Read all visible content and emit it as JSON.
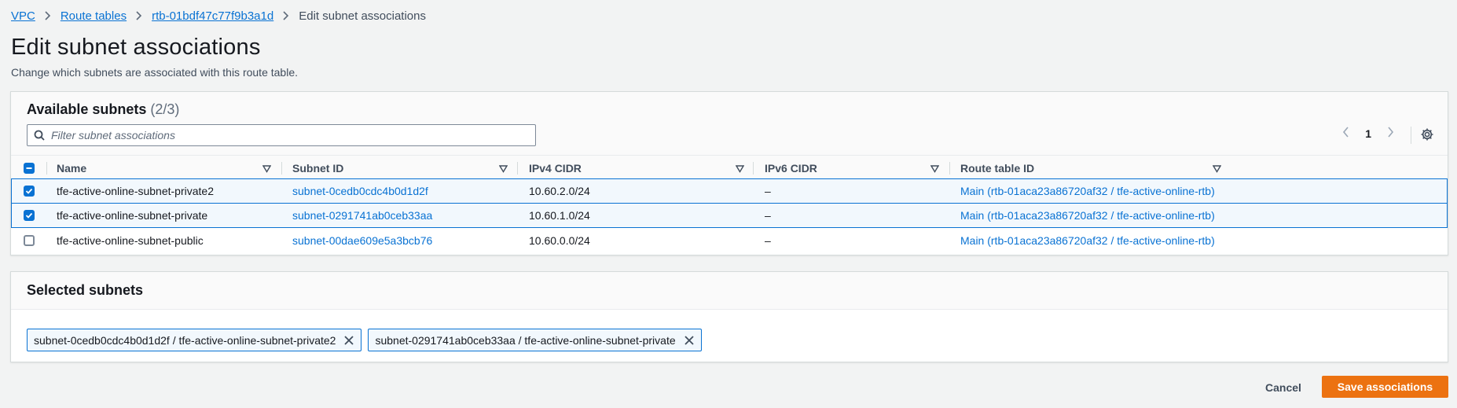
{
  "breadcrumb": {
    "items": [
      "VPC",
      "Route tables",
      "rtb-01bdf47c77f9b3a1d"
    ],
    "current": "Edit subnet associations"
  },
  "page": {
    "title": "Edit subnet associations",
    "description": "Change which subnets are associated with this route table."
  },
  "available": {
    "title": "Available subnets",
    "count": "(2/3)",
    "filter_placeholder": "Filter subnet associations",
    "page_number": "1",
    "columns": [
      "Name",
      "Subnet ID",
      "IPv4 CIDR",
      "IPv6 CIDR",
      "Route table ID"
    ],
    "rows": [
      {
        "checked": true,
        "name": "tfe-active-online-subnet-private2",
        "subnet_id": "subnet-0cedb0cdc4b0d1d2f",
        "ipv4": "10.60.2.0/24",
        "ipv6": "–",
        "route_table": "Main (rtb-01aca23a86720af32 / tfe-active-online-rtb)"
      },
      {
        "checked": true,
        "name": "tfe-active-online-subnet-private",
        "subnet_id": "subnet-0291741ab0ceb33aa",
        "ipv4": "10.60.1.0/24",
        "ipv6": "–",
        "route_table": "Main (rtb-01aca23a86720af32 / tfe-active-online-rtb)"
      },
      {
        "checked": false,
        "name": "tfe-active-online-subnet-public",
        "subnet_id": "subnet-00dae609e5a3bcb76",
        "ipv4": "10.60.0.0/24",
        "ipv6": "–",
        "route_table": "Main (rtb-01aca23a86720af32 / tfe-active-online-rtb)"
      }
    ]
  },
  "selected": {
    "title": "Selected subnets",
    "tokens": [
      "subnet-0cedb0cdc4b0d1d2f / tfe-active-online-subnet-private2",
      "subnet-0291741ab0ceb33aa / tfe-active-online-subnet-private"
    ]
  },
  "footer": {
    "cancel_label": "Cancel",
    "save_label": "Save associations"
  },
  "colors": {
    "link": "#0972d3",
    "primary_button": "#ec7211",
    "selected_row_bg": "#f2f8fd"
  }
}
